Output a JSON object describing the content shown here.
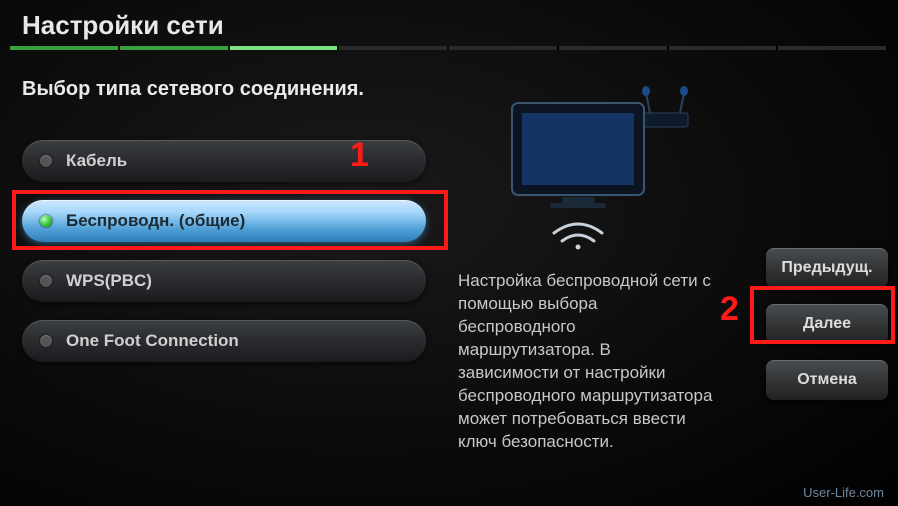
{
  "title": "Настройки сети",
  "subtitle": "Выбор типа сетевого соединения.",
  "options": [
    {
      "label": "Кабель",
      "selected": false
    },
    {
      "label": "Беспроводн. (общие)",
      "selected": true
    },
    {
      "label": "WPS(PBC)",
      "selected": false
    },
    {
      "label": "One Foot Connection",
      "selected": false
    }
  ],
  "description": "Настройка беспроводной сети с помощью выбора беспроводного маршрутизатора. В зависимости от настройки беспроводного маршрутизатора может потребоваться ввести ключ безопасности.",
  "buttons": {
    "prev": "Предыдущ.",
    "next": "Далее",
    "cancel": "Отмена"
  },
  "annotations": {
    "one": "1",
    "two": "2"
  },
  "watermark": "User-Life.com",
  "progress": {
    "total": 8,
    "completed": 2,
    "current_index": 2
  }
}
